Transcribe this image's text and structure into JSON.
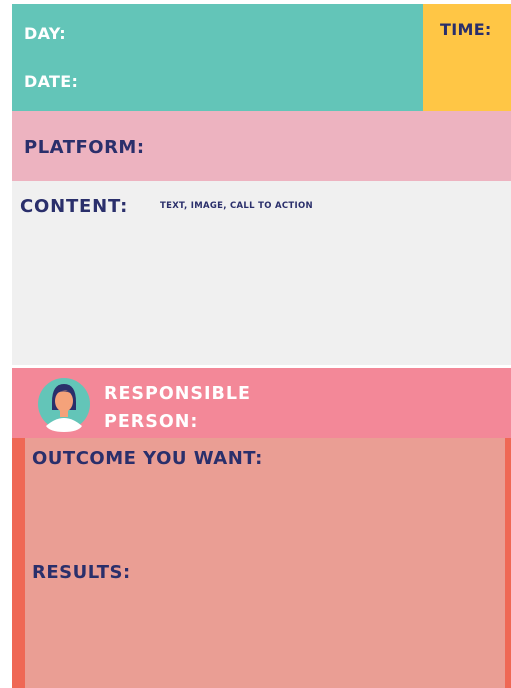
{
  "header": {
    "day_label": "DAY:",
    "date_label": "DATE:",
    "time_label": "TIME:"
  },
  "platform": {
    "label": "PLATFORM:"
  },
  "content": {
    "label": "CONTENT:",
    "hint": "TEXT, IMAGE, CALL TO ACTION"
  },
  "responsible": {
    "label_line1": "RESPONSIBLE",
    "label_line2": "PERSON:",
    "avatar_icon": "person-avatar-icon"
  },
  "outcome": {
    "label": "OUTCOME YOU WANT:"
  },
  "results": {
    "label": "RESULTS:"
  },
  "colors": {
    "teal": "#63c5b8",
    "yellow": "#ffc645",
    "light_pink": "#edb3c0",
    "light_gray": "#f0f0f0",
    "pink": "#f38898",
    "salmon": "#ea9e94",
    "coral": "#ef6855",
    "navy": "#2a2f6b"
  }
}
